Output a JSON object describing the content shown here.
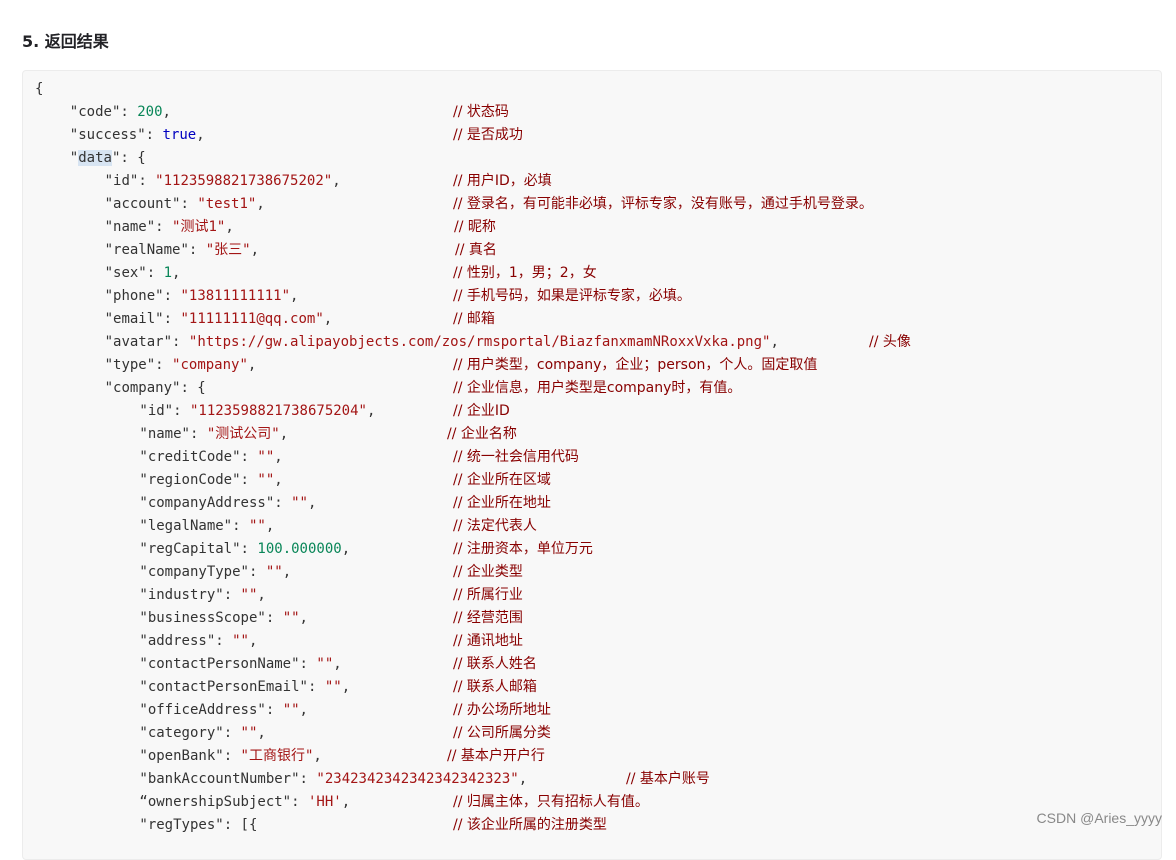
{
  "heading": "5. 返回结果",
  "watermark": "CSDN @Aries_yyyy",
  "code_lines": [
    {
      "indent": 0,
      "tokens": [
        {
          "t": "{",
          "c": "p"
        }
      ],
      "comment": ""
    },
    {
      "indent": 1,
      "tokens": [
        {
          "t": "\"code\"",
          "c": "k"
        },
        {
          "t": ": ",
          "c": "p"
        },
        {
          "t": "200",
          "c": "n"
        },
        {
          "t": ",",
          "c": "p"
        }
      ],
      "comment": "// 状态码"
    },
    {
      "indent": 1,
      "tokens": [
        {
          "t": "\"success\"",
          "c": "k"
        },
        {
          "t": ": ",
          "c": "p"
        },
        {
          "t": "true",
          "c": "b"
        },
        {
          "t": ",",
          "c": "p"
        }
      ],
      "comment": "// 是否成功"
    },
    {
      "indent": 1,
      "tokens": [
        {
          "t": "\"",
          "c": "k"
        },
        {
          "t": "data",
          "c": "k hl"
        },
        {
          "t": "\"",
          "c": "k"
        },
        {
          "t": ": {",
          "c": "p"
        }
      ],
      "comment": ""
    },
    {
      "indent": 2,
      "tokens": [
        {
          "t": "\"id\"",
          "c": "k"
        },
        {
          "t": ": ",
          "c": "p"
        },
        {
          "t": "\"1123598821738675202\"",
          "c": "s"
        },
        {
          "t": ",",
          "c": "p"
        }
      ],
      "comment": "// 用户ID，必填"
    },
    {
      "indent": 2,
      "tokens": [
        {
          "t": "\"account\"",
          "c": "k"
        },
        {
          "t": ": ",
          "c": "p"
        },
        {
          "t": "\"test1\"",
          "c": "s"
        },
        {
          "t": ",",
          "c": "p"
        }
      ],
      "comment": "// 登录名，有可能非必填，评标专家，没有账号，通过手机号登录。"
    },
    {
      "indent": 2,
      "tokens": [
        {
          "t": "\"name\"",
          "c": "k"
        },
        {
          "t": ": ",
          "c": "p"
        },
        {
          "t": "\"测试1\"",
          "c": "s"
        },
        {
          "t": ",",
          "c": "p"
        }
      ],
      "comment": "// 昵称"
    },
    {
      "indent": 2,
      "tokens": [
        {
          "t": "\"realName\"",
          "c": "k"
        },
        {
          "t": ": ",
          "c": "p"
        },
        {
          "t": "\"张三\"",
          "c": "s"
        },
        {
          "t": ",",
          "c": "p"
        }
      ],
      "comment": "// 真名"
    },
    {
      "indent": 2,
      "tokens": [
        {
          "t": "\"sex\"",
          "c": "k"
        },
        {
          "t": ": ",
          "c": "p"
        },
        {
          "t": "1",
          "c": "n"
        },
        {
          "t": ",",
          "c": "p"
        }
      ],
      "comment": "// 性别，1，男；2，女"
    },
    {
      "indent": 2,
      "tokens": [
        {
          "t": "\"phone\"",
          "c": "k"
        },
        {
          "t": ": ",
          "c": "p"
        },
        {
          "t": "\"13811111111\"",
          "c": "s"
        },
        {
          "t": ",",
          "c": "p"
        }
      ],
      "comment": "// 手机号码，如果是评标专家，必填。"
    },
    {
      "indent": 2,
      "tokens": [
        {
          "t": "\"email\"",
          "c": "k"
        },
        {
          "t": ": ",
          "c": "p"
        },
        {
          "t": "\"11111111@qq.com\"",
          "c": "s"
        },
        {
          "t": ",",
          "c": "p"
        }
      ],
      "comment": "// 邮箱"
    },
    {
      "indent": 2,
      "tokens": [
        {
          "t": "\"avatar\"",
          "c": "k"
        },
        {
          "t": ": ",
          "c": "p"
        },
        {
          "t": "\"https://gw.alipayobjects.com/zos/rmsportal/BiazfanxmamNRoxxVxka.png\"",
          "c": "s"
        },
        {
          "t": ",",
          "c": "p"
        }
      ],
      "comment": "// 头像"
    },
    {
      "indent": 2,
      "tokens": [
        {
          "t": "\"type\"",
          "c": "k"
        },
        {
          "t": ": ",
          "c": "p"
        },
        {
          "t": "\"company\"",
          "c": "s"
        },
        {
          "t": ",",
          "c": "p"
        }
      ],
      "comment": "// 用户类型，company，企业；person，个人。固定取值"
    },
    {
      "indent": 2,
      "tokens": [
        {
          "t": "\"company\"",
          "c": "k"
        },
        {
          "t": ": {",
          "c": "p"
        }
      ],
      "comment": "// 企业信息，用户类型是company时，有值。"
    },
    {
      "indent": 3,
      "tokens": [
        {
          "t": "\"id\"",
          "c": "k"
        },
        {
          "t": ": ",
          "c": "p"
        },
        {
          "t": "\"1123598821738675204\"",
          "c": "s"
        },
        {
          "t": ",",
          "c": "p"
        }
      ],
      "comment": "// 企业ID"
    },
    {
      "indent": 3,
      "tokens": [
        {
          "t": "\"name\"",
          "c": "k"
        },
        {
          "t": ": ",
          "c": "p"
        },
        {
          "t": "\"测试公司\"",
          "c": "s"
        },
        {
          "t": ",",
          "c": "p"
        }
      ],
      "comment": "// 企业名称"
    },
    {
      "indent": 3,
      "tokens": [
        {
          "t": "\"creditCode\"",
          "c": "k"
        },
        {
          "t": ": ",
          "c": "p"
        },
        {
          "t": "\"\"",
          "c": "s"
        },
        {
          "t": ",",
          "c": "p"
        }
      ],
      "comment": "// 统一社会信用代码"
    },
    {
      "indent": 3,
      "tokens": [
        {
          "t": "\"regionCode\"",
          "c": "k"
        },
        {
          "t": ": ",
          "c": "p"
        },
        {
          "t": "\"\"",
          "c": "s"
        },
        {
          "t": ",",
          "c": "p"
        }
      ],
      "comment": "// 企业所在区域"
    },
    {
      "indent": 3,
      "tokens": [
        {
          "t": "\"companyAddress\"",
          "c": "k"
        },
        {
          "t": ": ",
          "c": "p"
        },
        {
          "t": "\"\"",
          "c": "s"
        },
        {
          "t": ",",
          "c": "p"
        }
      ],
      "comment": "// 企业所在地址"
    },
    {
      "indent": 3,
      "tokens": [
        {
          "t": "\"legalName\"",
          "c": "k"
        },
        {
          "t": ": ",
          "c": "p"
        },
        {
          "t": "\"\"",
          "c": "s"
        },
        {
          "t": ",",
          "c": "p"
        }
      ],
      "comment": "// 法定代表人"
    },
    {
      "indent": 3,
      "tokens": [
        {
          "t": "\"regCapital\"",
          "c": "k"
        },
        {
          "t": ": ",
          "c": "p"
        },
        {
          "t": "100.000000",
          "c": "n"
        },
        {
          "t": ",",
          "c": "p"
        }
      ],
      "comment": "// 注册资本，单位万元"
    },
    {
      "indent": 3,
      "tokens": [
        {
          "t": "\"companyType\"",
          "c": "k"
        },
        {
          "t": ": ",
          "c": "p"
        },
        {
          "t": "\"\"",
          "c": "s"
        },
        {
          "t": ",",
          "c": "p"
        }
      ],
      "comment": "// 企业类型"
    },
    {
      "indent": 3,
      "tokens": [
        {
          "t": "\"industry\"",
          "c": "k"
        },
        {
          "t": ": ",
          "c": "p"
        },
        {
          "t": "\"\"",
          "c": "s"
        },
        {
          "t": ",",
          "c": "p"
        }
      ],
      "comment": "// 所属行业"
    },
    {
      "indent": 3,
      "tokens": [
        {
          "t": "\"businessScope\"",
          "c": "k"
        },
        {
          "t": ": ",
          "c": "p"
        },
        {
          "t": "\"\"",
          "c": "s"
        },
        {
          "t": ",",
          "c": "p"
        }
      ],
      "comment": "// 经营范围"
    },
    {
      "indent": 3,
      "tokens": [
        {
          "t": "\"address\"",
          "c": "k"
        },
        {
          "t": ": ",
          "c": "p"
        },
        {
          "t": "\"\"",
          "c": "s"
        },
        {
          "t": ",",
          "c": "p"
        }
      ],
      "comment": "// 通讯地址"
    },
    {
      "indent": 3,
      "tokens": [
        {
          "t": "\"contactPersonName\"",
          "c": "k"
        },
        {
          "t": ": ",
          "c": "p"
        },
        {
          "t": "\"\"",
          "c": "s"
        },
        {
          "t": ",",
          "c": "p"
        }
      ],
      "comment": "// 联系人姓名"
    },
    {
      "indent": 3,
      "tokens": [
        {
          "t": "\"contactPersonEmail\"",
          "c": "k"
        },
        {
          "t": ": ",
          "c": "p"
        },
        {
          "t": "\"\"",
          "c": "s"
        },
        {
          "t": ",",
          "c": "p"
        }
      ],
      "comment": "// 联系人邮箱"
    },
    {
      "indent": 3,
      "tokens": [
        {
          "t": "\"officeAddress\"",
          "c": "k"
        },
        {
          "t": ": ",
          "c": "p"
        },
        {
          "t": "\"\"",
          "c": "s"
        },
        {
          "t": ",",
          "c": "p"
        }
      ],
      "comment": "// 办公场所地址"
    },
    {
      "indent": 3,
      "tokens": [
        {
          "t": "\"category\"",
          "c": "k"
        },
        {
          "t": ": ",
          "c": "p"
        },
        {
          "t": "\"\"",
          "c": "s"
        },
        {
          "t": ",",
          "c": "p"
        }
      ],
      "comment": "// 公司所属分类"
    },
    {
      "indent": 3,
      "tokens": [
        {
          "t": "\"openBank\"",
          "c": "k"
        },
        {
          "t": ": ",
          "c": "p"
        },
        {
          "t": "\"工商银行\"",
          "c": "s"
        },
        {
          "t": ",",
          "c": "p"
        }
      ],
      "comment": "// 基本户开户行"
    },
    {
      "indent": 3,
      "tokens": [
        {
          "t": "\"bankAccountNumber\"",
          "c": "k"
        },
        {
          "t": ": ",
          "c": "p"
        },
        {
          "t": "\"2342342342342342342323\"",
          "c": "s"
        },
        {
          "t": ",",
          "c": "p"
        }
      ],
      "comment": "// 基本户账号"
    },
    {
      "indent": 3,
      "tokens": [
        {
          "t": "“ownershipSubject\"",
          "c": "k"
        },
        {
          "t": ": ",
          "c": "p"
        },
        {
          "t": "'HH'",
          "c": "s"
        },
        {
          "t": ",",
          "c": "p"
        }
      ],
      "comment": "// 归属主体，只有招标人有值。"
    },
    {
      "indent": 3,
      "tokens": [
        {
          "t": "\"regTypes\"",
          "c": "k"
        },
        {
          "t": ": [{",
          "c": "p"
        }
      ],
      "comment": "// 该企业所属的注册类型"
    }
  ]
}
